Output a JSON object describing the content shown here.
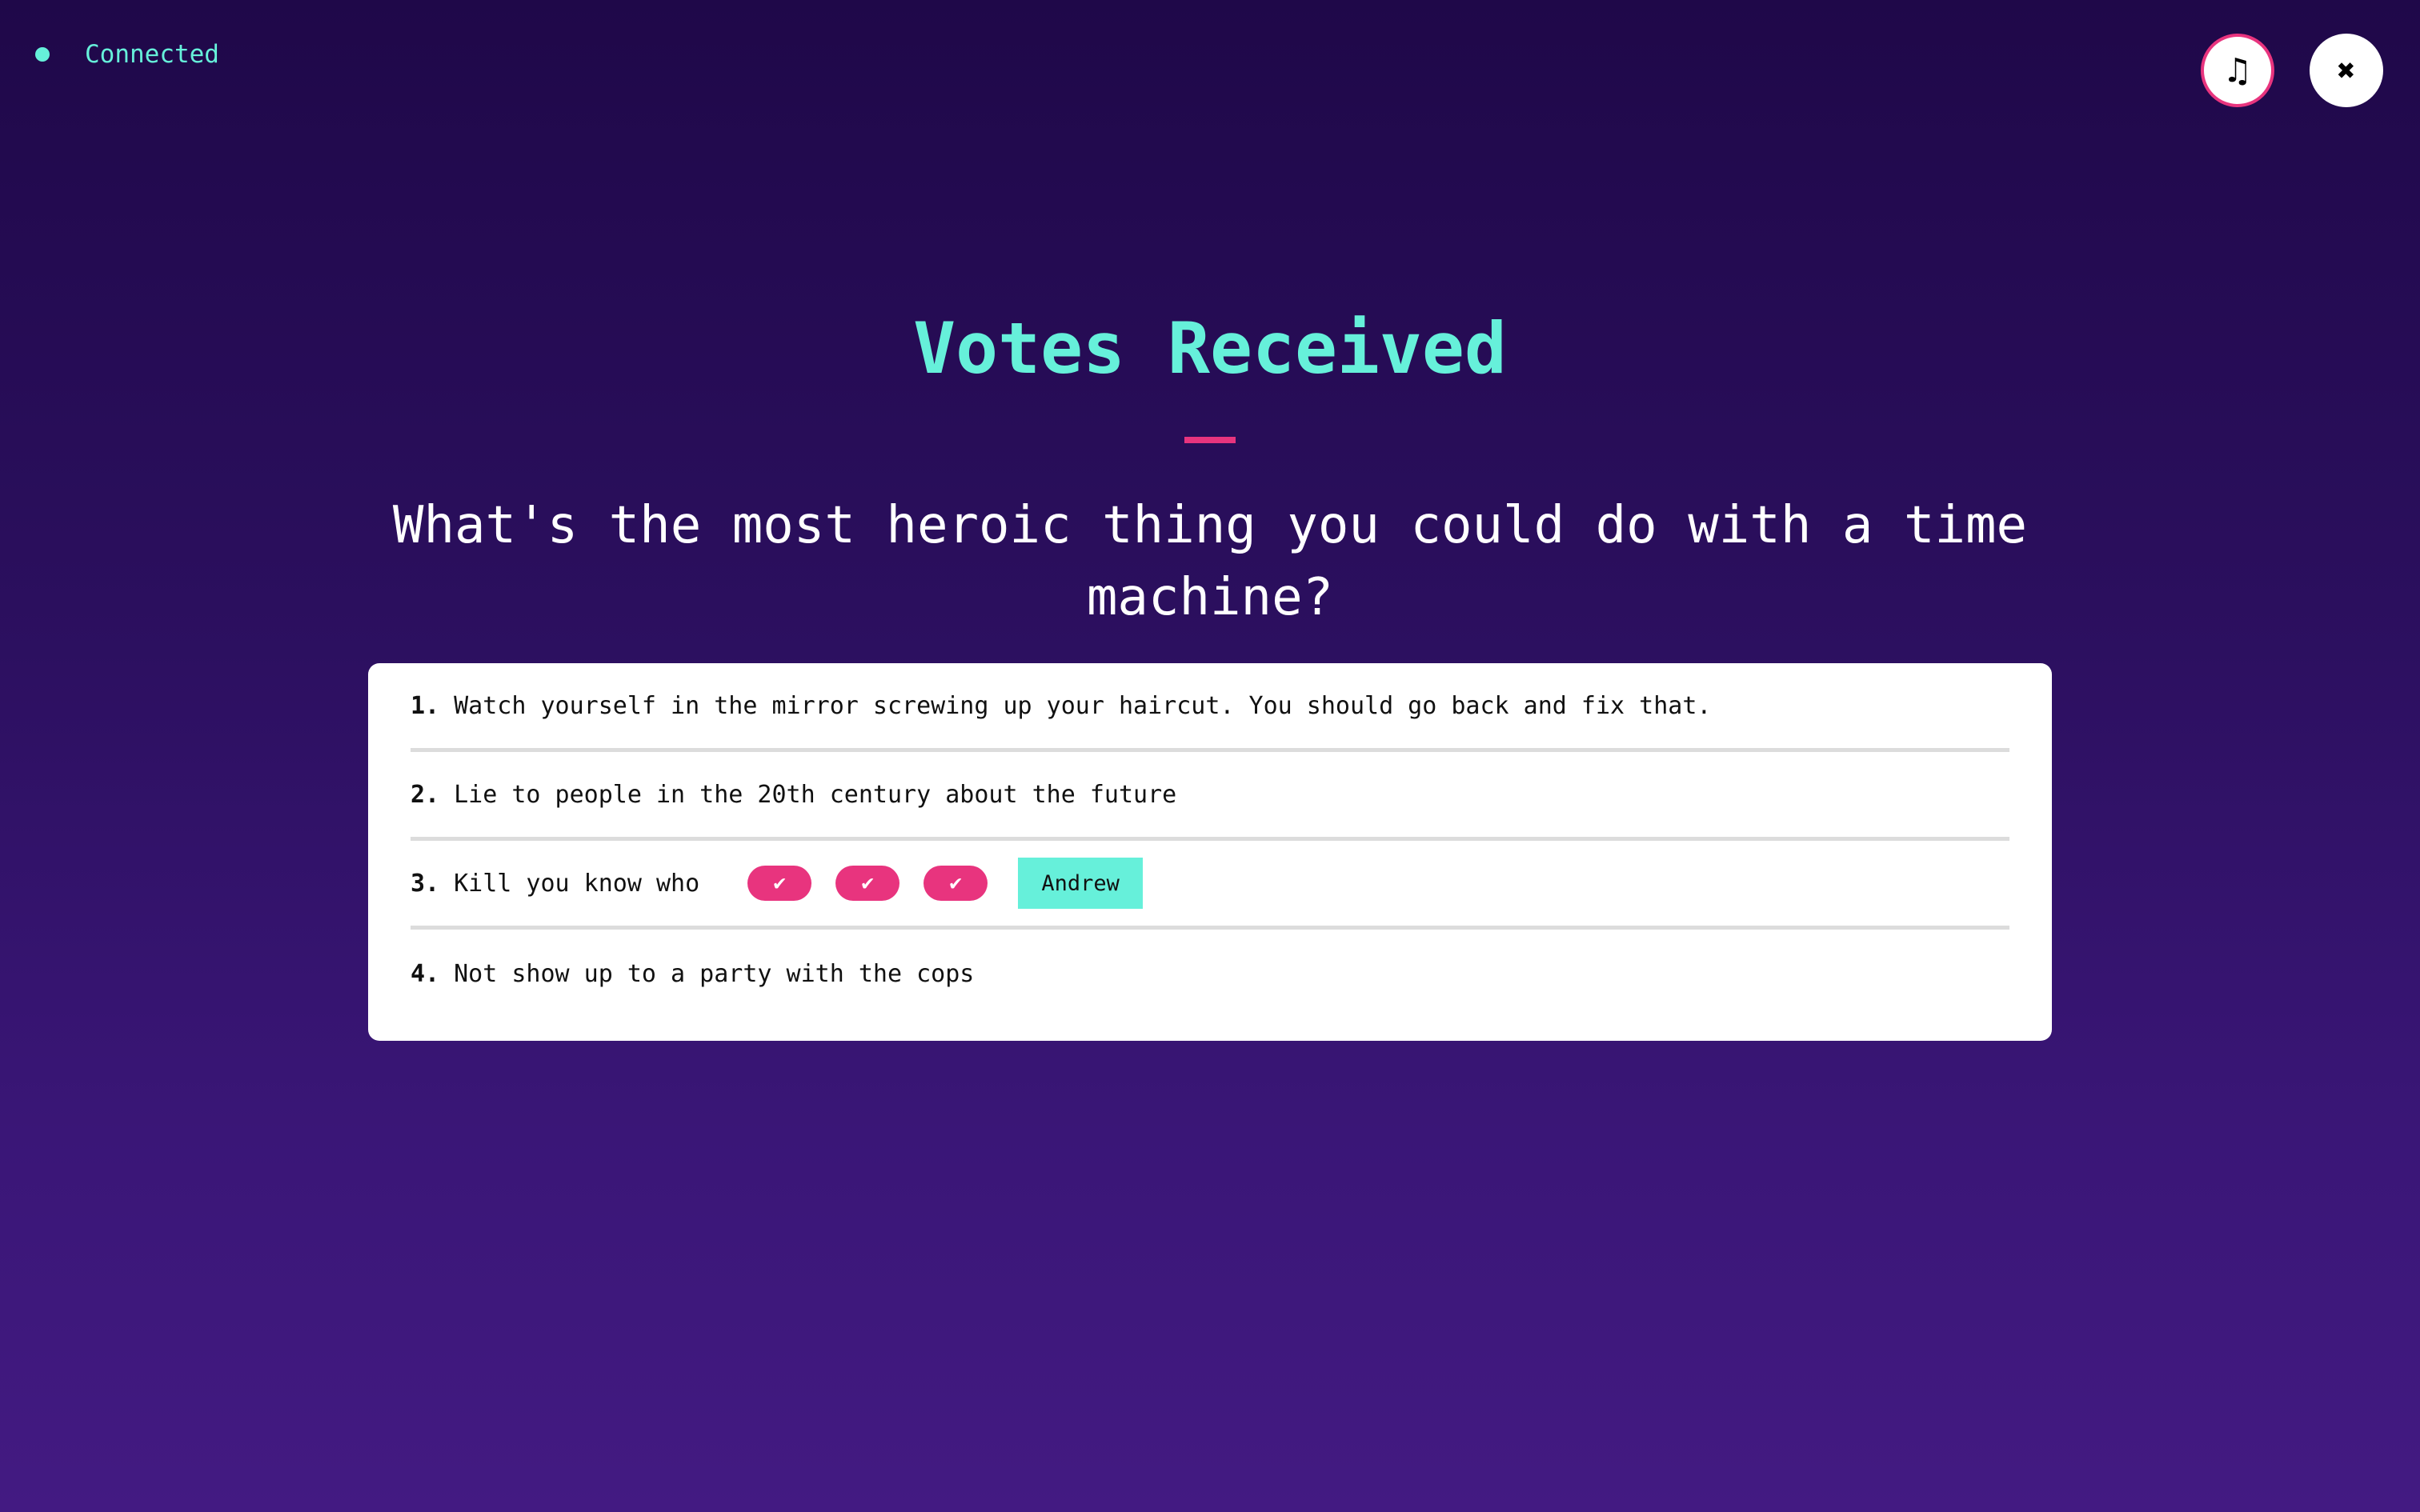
{
  "status": {
    "text": "Connected",
    "color": "#66f0da"
  },
  "buttons": {
    "music_icon": "music-note-icon",
    "music_glyph": "♫",
    "close_icon": "close-icon",
    "close_glyph": "✖"
  },
  "header": {
    "title": "Votes Received",
    "question": "What's the most heroic thing you could do with a time machine?"
  },
  "answers": [
    {
      "num": "1.",
      "text": "Watch yourself in the mirror screwing up your haircut. You should go back and fix that."
    },
    {
      "num": "2.",
      "text": "Lie to people in the 20th century about the future"
    },
    {
      "num": "3.",
      "text": "Kill you know who",
      "votes": [
        "✔",
        "✔",
        "✔"
      ],
      "author": "Andrew"
    },
    {
      "num": "4.",
      "text": "Not show up to a party with the cops"
    }
  ],
  "colors": {
    "accent": "#66f0da",
    "highlight": "#e8347e",
    "background_top": "#1f0849",
    "background_bottom": "#431a82"
  }
}
